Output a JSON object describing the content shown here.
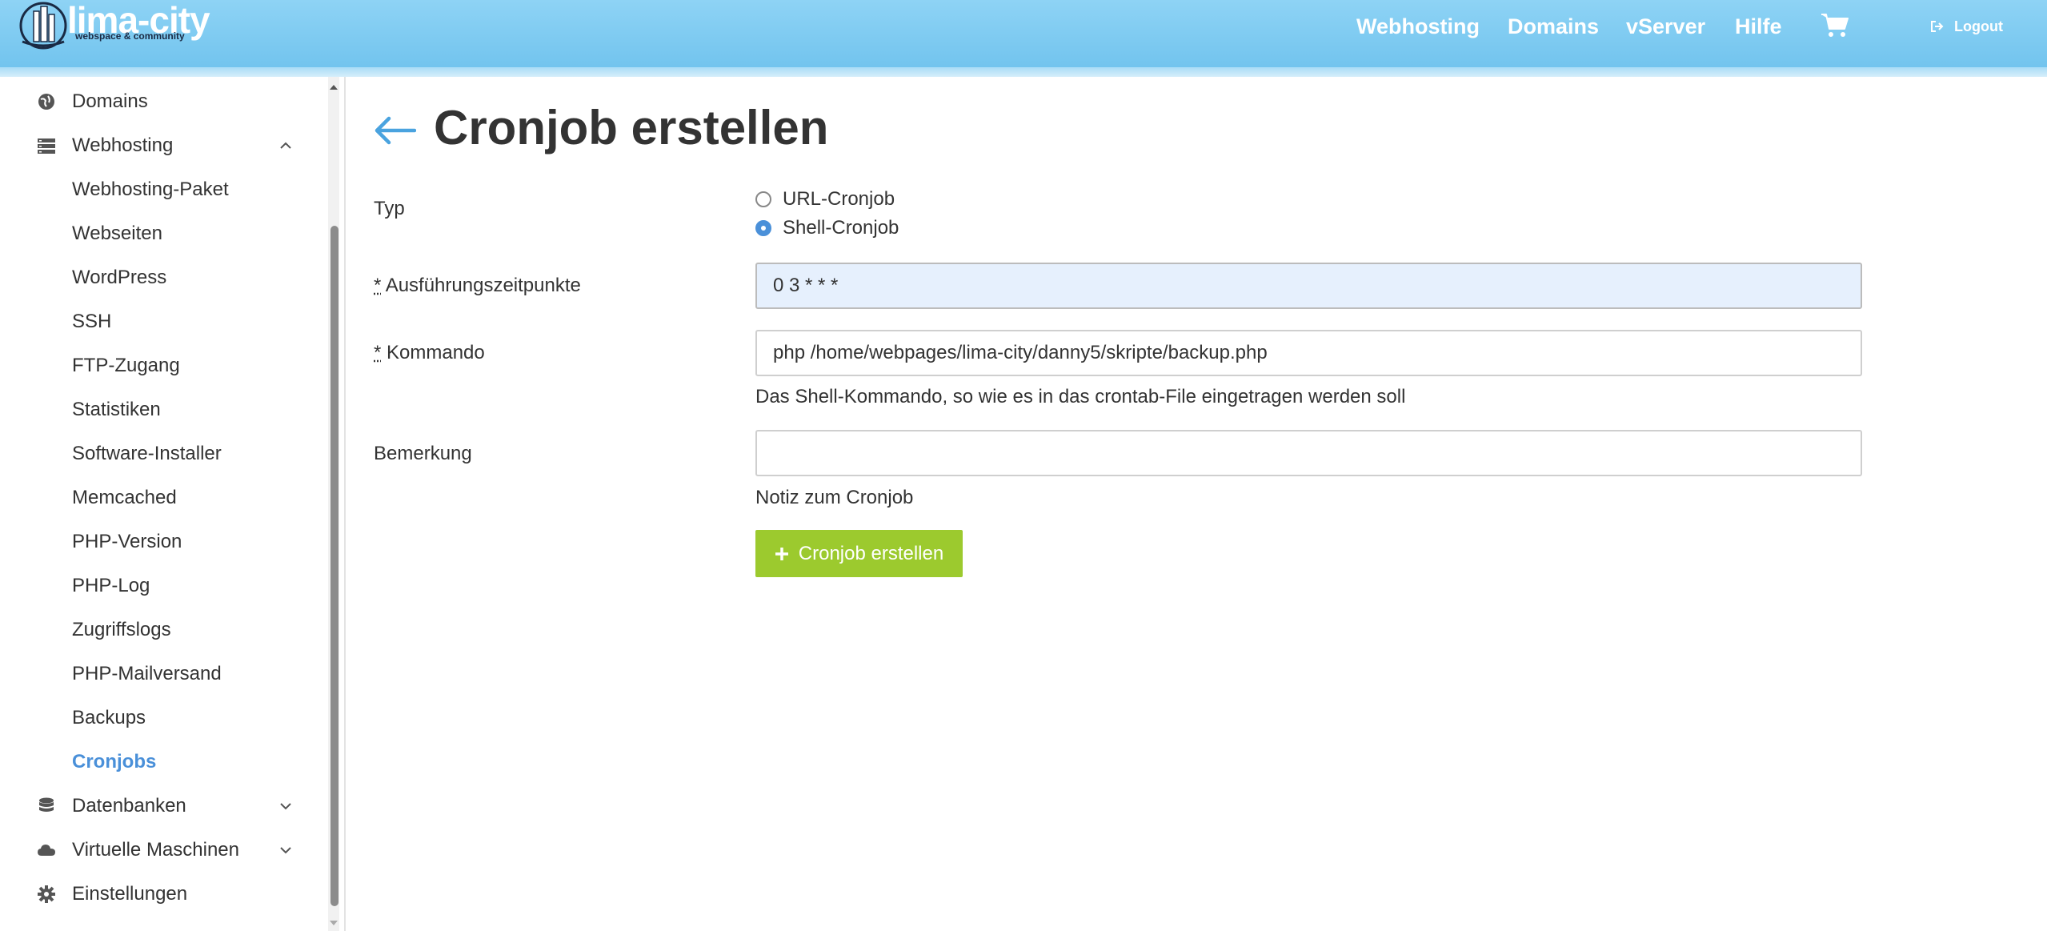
{
  "brand": {
    "name": "lima-city",
    "tagline": "webspace & community"
  },
  "nav": {
    "webhosting": "Webhosting",
    "domains": "Domains",
    "vserver": "vServer",
    "hilfe": "Hilfe",
    "logout": "Logout"
  },
  "sidebar": {
    "domains": "Domains",
    "webhosting": "Webhosting",
    "sub": [
      "Webhosting-Paket",
      "Webseiten",
      "WordPress",
      "SSH",
      "FTP-Zugang",
      "Statistiken",
      "Software-Installer",
      "Memcached",
      "PHP-Version",
      "PHP-Log",
      "Zugriffslogs",
      "PHP-Mailversand",
      "Backups",
      "Cronjobs"
    ],
    "datenbanken": "Datenbanken",
    "vms": "Virtuelle Maschinen",
    "einstellungen": "Einstellungen"
  },
  "page": {
    "title": "Cronjob erstellen"
  },
  "form": {
    "typ_label": "Typ",
    "radio_url": "URL-Cronjob",
    "radio_shell": "Shell-Cronjob",
    "required_mark": "*",
    "zeit_label": "Ausführungszeitpunkte",
    "zeit_value": "0 3 * * *",
    "kommando_label": "Kommando",
    "kommando_value": "php /home/webpages/lima-city/danny5/skripte/backup.php",
    "kommando_help": "Das Shell-Kommando, so wie es in das crontab-File eingetragen werden soll",
    "bemerkung_label": "Bemerkung",
    "bemerkung_value": "",
    "bemerkung_help": "Notiz zum Cronjob",
    "submit": "Cronjob erstellen"
  },
  "colors": {
    "header": "#7cc9f0",
    "accent": "#4a90d9",
    "submit": "#9cca2e"
  }
}
